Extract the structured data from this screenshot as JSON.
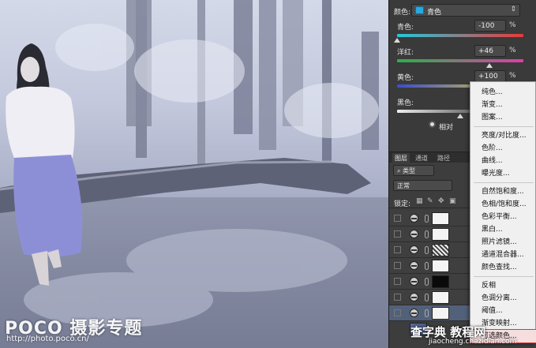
{
  "photo": {
    "watermark_logo": "POCO 摄影专题",
    "watermark_url": "http://photo.poco.cn/"
  },
  "adjustments": {
    "colors_label": "颜色:",
    "colors_value": "青色",
    "swatch_color": "#29a9e1",
    "sliders": [
      {
        "label": "青色:",
        "value": "-100",
        "unit": "%",
        "position": -100
      },
      {
        "label": "洋红:",
        "value": "+46",
        "unit": "%",
        "position": 46
      },
      {
        "label": "黄色:",
        "value": "+100",
        "unit": "%",
        "position": 100
      },
      {
        "label": "黑色:",
        "value": "",
        "unit": "",
        "position": 0
      }
    ],
    "method_label": "相对"
  },
  "layers": {
    "tabs": [
      "图层",
      "通道",
      "路径"
    ],
    "filter_type": "类型",
    "blend_mode": "正常",
    "lock_label": "锁定:",
    "rows": [
      {
        "mask": "white",
        "selected": false
      },
      {
        "mask": "white",
        "selected": false
      },
      {
        "mask": "noise",
        "selected": false
      },
      {
        "mask": "white",
        "selected": false
      },
      {
        "mask": "black",
        "selected": false
      },
      {
        "mask": "white",
        "selected": false
      },
      {
        "mask": "white",
        "selected": true
      }
    ]
  },
  "menu": {
    "items": [
      {
        "label": "纯色..."
      },
      {
        "label": "渐变..."
      },
      {
        "label": "图案..."
      },
      {
        "sep": true
      },
      {
        "label": "亮度/对比度..."
      },
      {
        "label": "色阶..."
      },
      {
        "label": "曲线..."
      },
      {
        "label": "曝光度..."
      },
      {
        "sep": true
      },
      {
        "label": "自然饱和度..."
      },
      {
        "label": "色相/饱和度..."
      },
      {
        "label": "色彩平衡..."
      },
      {
        "label": "黑白..."
      },
      {
        "label": "照片滤镜..."
      },
      {
        "label": "通道混合器..."
      },
      {
        "label": "颜色查找..."
      },
      {
        "sep": true
      },
      {
        "label": "反相"
      },
      {
        "label": "色调分离..."
      },
      {
        "label": "阈值..."
      },
      {
        "label": "渐变映射..."
      },
      {
        "label": "可选颜色...",
        "highlight": true
      }
    ]
  },
  "footer_watermark": {
    "brand": "查字典 教程网",
    "url": "jiaocheng.chazidian.com"
  }
}
